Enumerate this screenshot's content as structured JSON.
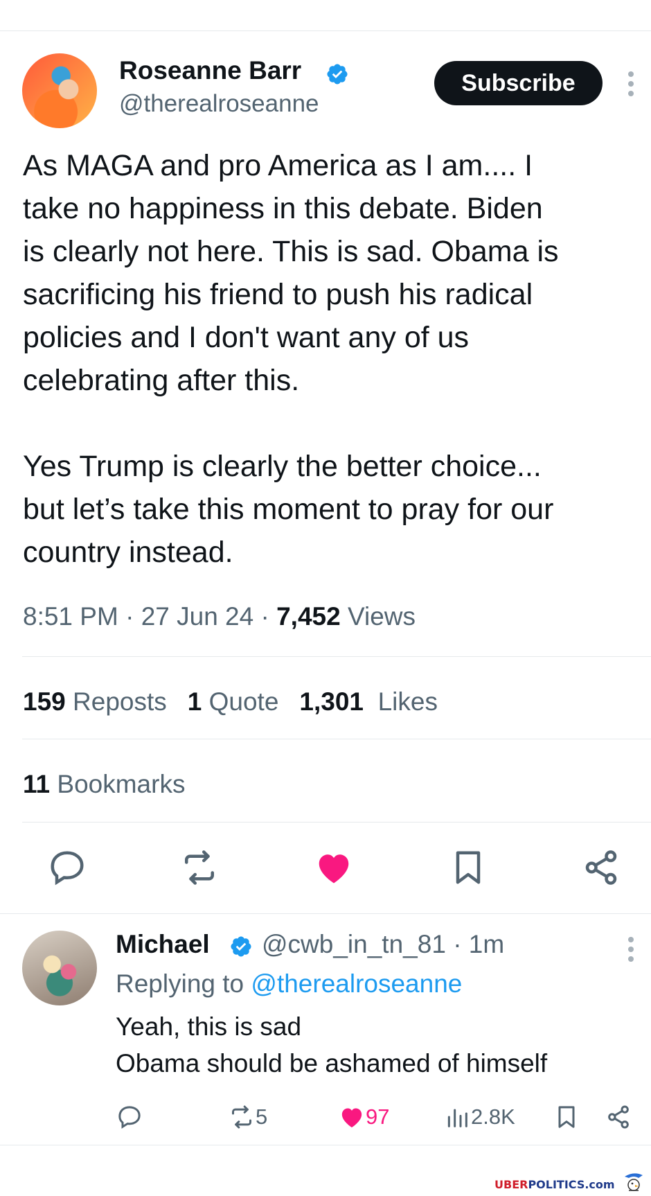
{
  "tweet": {
    "author_name": "Roseanne Barr",
    "author_handle": "@therealroseanne",
    "subscribe_label": "Subscribe",
    "text": "As MAGA and pro America as I am.... I\ntake no happiness in this debate. Biden\nis clearly not here. This is sad. Obama is\nsacrificing his friend to push his radical\npolicies and I don't want any of us\ncelebrating after this.\n\nYes Trump is clearly the better choice...\nbut let’s take this moment to pray for our\ncountry instead.",
    "time": "8:51 PM",
    "date": "27 Jun 24",
    "views_count": "7,452",
    "views_label": "Views",
    "reposts_count": "159",
    "reposts_label": "Reposts",
    "quotes_count": "1",
    "quotes_label": "Quote",
    "likes_count": "1,301",
    "likes_label": "Likes",
    "bookmarks_count": "11",
    "bookmarks_label": "Bookmarks"
  },
  "reply": {
    "author_name": "Michael",
    "author_handle": "@cwb_in_tn_81",
    "age": "1m",
    "replying_label": "Replying to",
    "replying_to": "@therealroseanne",
    "text": "Yeah, this is sad\nObama should be ashamed of himself",
    "reposts": "5",
    "likes": "97",
    "views": "2.8K"
  },
  "watermark": {
    "brand_red": "UBER",
    "brand_blue": "POLITICS",
    "suffix": ".com"
  },
  "colors": {
    "like_pink": "#f91880",
    "verified_blue": "#1d9bf0",
    "muted_gray": "#536471"
  }
}
